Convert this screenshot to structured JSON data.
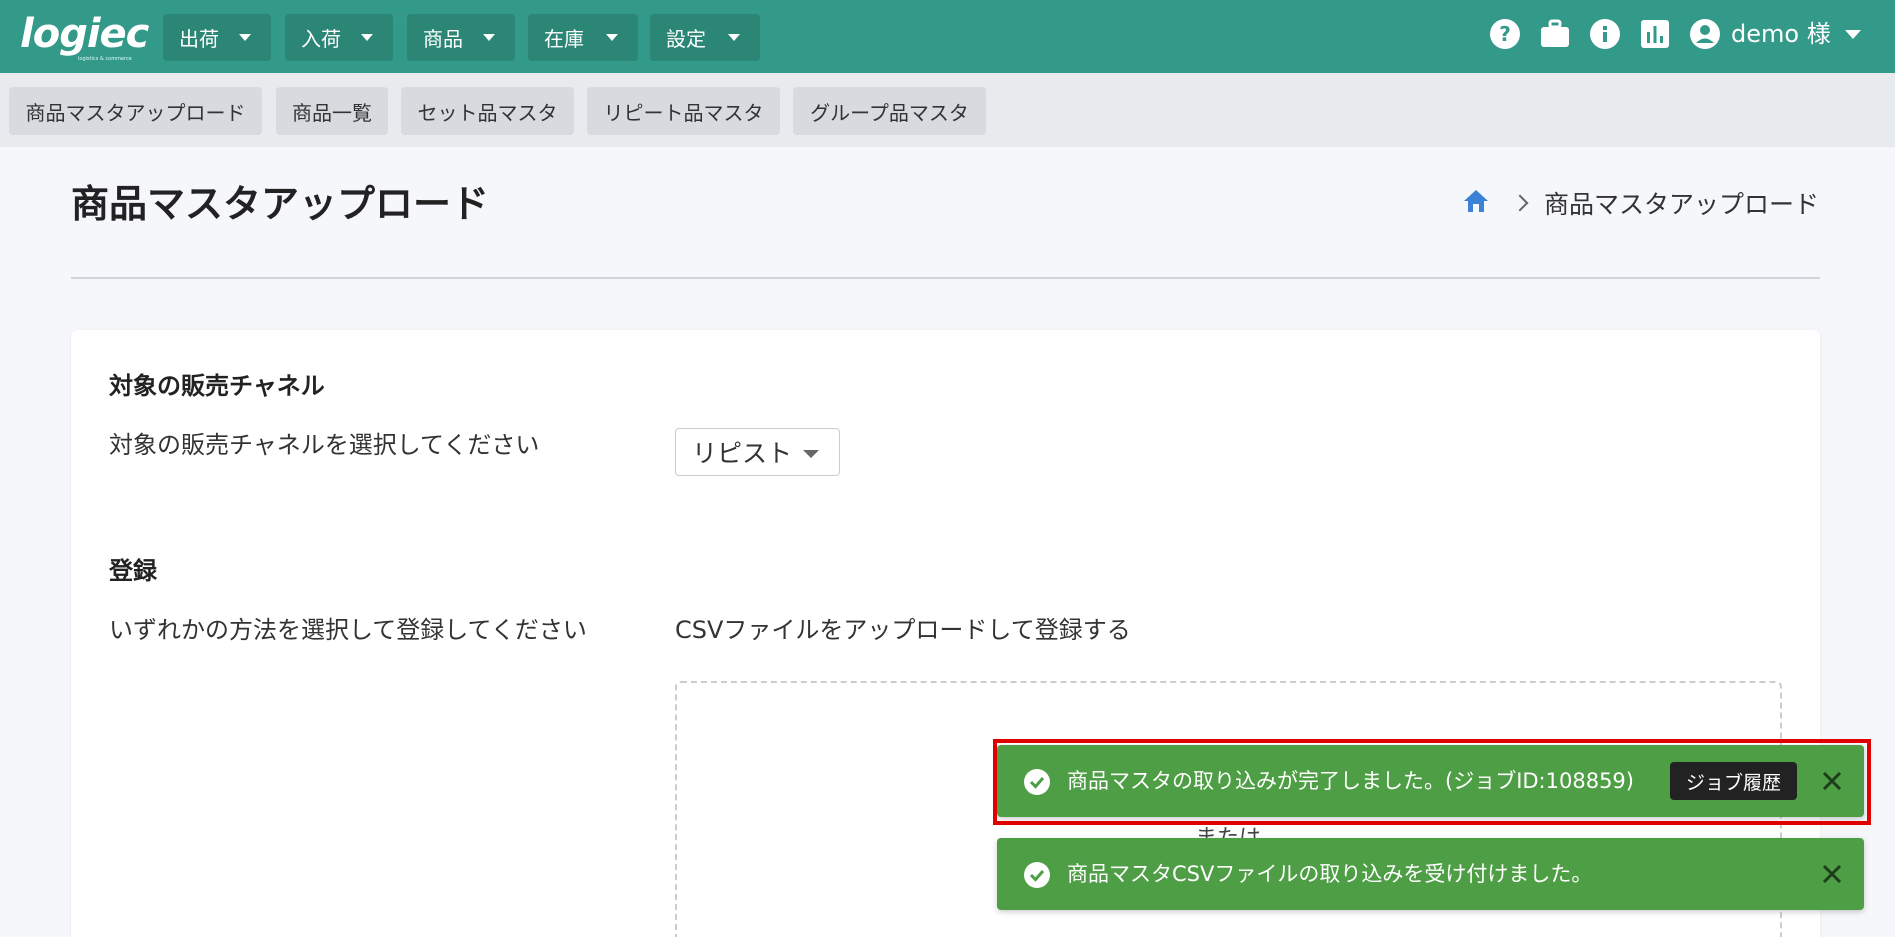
{
  "app": {
    "logo_text": "logiec",
    "logo_sub": "logistics & commerce"
  },
  "topnav": {
    "items": [
      {
        "label": "出荷"
      },
      {
        "label": "入荷"
      },
      {
        "label": "商品"
      },
      {
        "label": "在庫"
      },
      {
        "label": "設定"
      }
    ],
    "icons": [
      "help-icon",
      "briefcase-icon",
      "info-icon",
      "chart-icon",
      "account-circle-icon"
    ],
    "user_label": "demo 様"
  },
  "subnav": {
    "items": [
      {
        "label": "商品マスタアップロード"
      },
      {
        "label": "商品一覧"
      },
      {
        "label": "セット品マスタ"
      },
      {
        "label": "リピート品マスタ"
      },
      {
        "label": "グループ品マスタ"
      }
    ]
  },
  "header": {
    "title": "商品マスタアップロード",
    "breadcrumb_current": "商品マスタアップロード"
  },
  "channel": {
    "title": "対象の販売チャネル",
    "description": "対象の販売チャネルを選択してください",
    "selected": "リピスト"
  },
  "register": {
    "title": "登録",
    "description": "いずれかの方法を選択して登録してください",
    "csv_label": "CSVファイルをアップロードして登録する",
    "dropzone_or": "または"
  },
  "toasts": [
    {
      "message": "商品マスタの取り込みが完了しました。(ジョブID:108859)",
      "action": "ジョブ履歴"
    },
    {
      "message": "商品マスタCSVファイルの取り込みを受け付けました。"
    }
  ],
  "colors": {
    "primary": "#339988",
    "toast": "#4e9e45",
    "highlight": "#e00000",
    "home_icon": "#3b82d6"
  }
}
